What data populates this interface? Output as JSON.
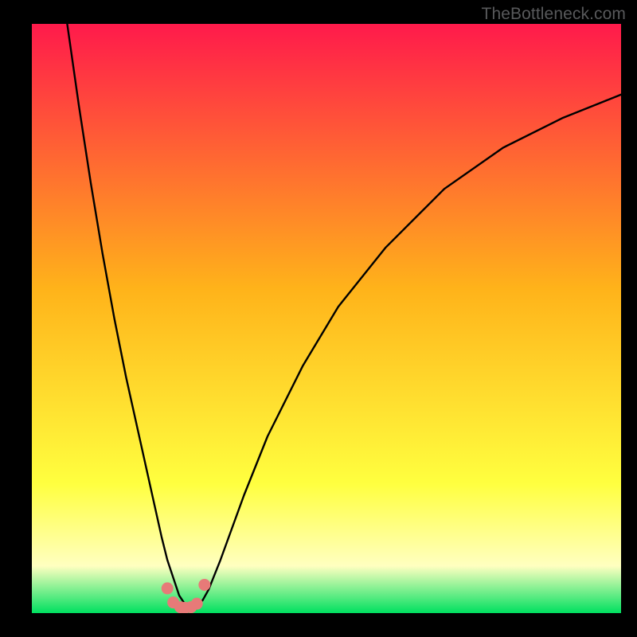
{
  "watermark": "TheBottleneck.com",
  "colors": {
    "frame": "#000000",
    "gradient_top": "#ff1a4b",
    "gradient_mid": "#ffb31a",
    "gradient_yellow": "#ffff3f",
    "gradient_paleyellow": "#ffffc0",
    "gradient_green": "#00e060",
    "curve": "#000000",
    "marker": "#e77a78"
  },
  "chart_data": {
    "type": "line",
    "title": "",
    "xlabel": "",
    "ylabel": "",
    "xlim": [
      0,
      100
    ],
    "ylim": [
      0,
      100
    ],
    "grid": false,
    "legend": false,
    "series": [
      {
        "name": "curve",
        "x": [
          6,
          8,
          10,
          12,
          14,
          16,
          18,
          20,
          22,
          23,
          24,
          25,
          26,
          27,
          28,
          29,
          30,
          32,
          36,
          40,
          46,
          52,
          60,
          70,
          80,
          90,
          100
        ],
        "y": [
          100,
          86,
          73,
          61,
          50,
          40,
          31,
          22,
          13,
          9,
          6,
          3,
          1.5,
          1,
          1.2,
          2.2,
          4,
          9,
          20,
          30,
          42,
          52,
          62,
          72,
          79,
          84,
          88
        ]
      }
    ],
    "markers": {
      "name": "highlight-points",
      "x": [
        23.0,
        24.0,
        25.2,
        26.0,
        27.0,
        28.0,
        29.3
      ],
      "y": [
        4.2,
        1.8,
        1.0,
        0.9,
        1.0,
        1.6,
        4.8
      ]
    },
    "notch": {
      "x": 26.0,
      "y_floor": 0
    }
  }
}
